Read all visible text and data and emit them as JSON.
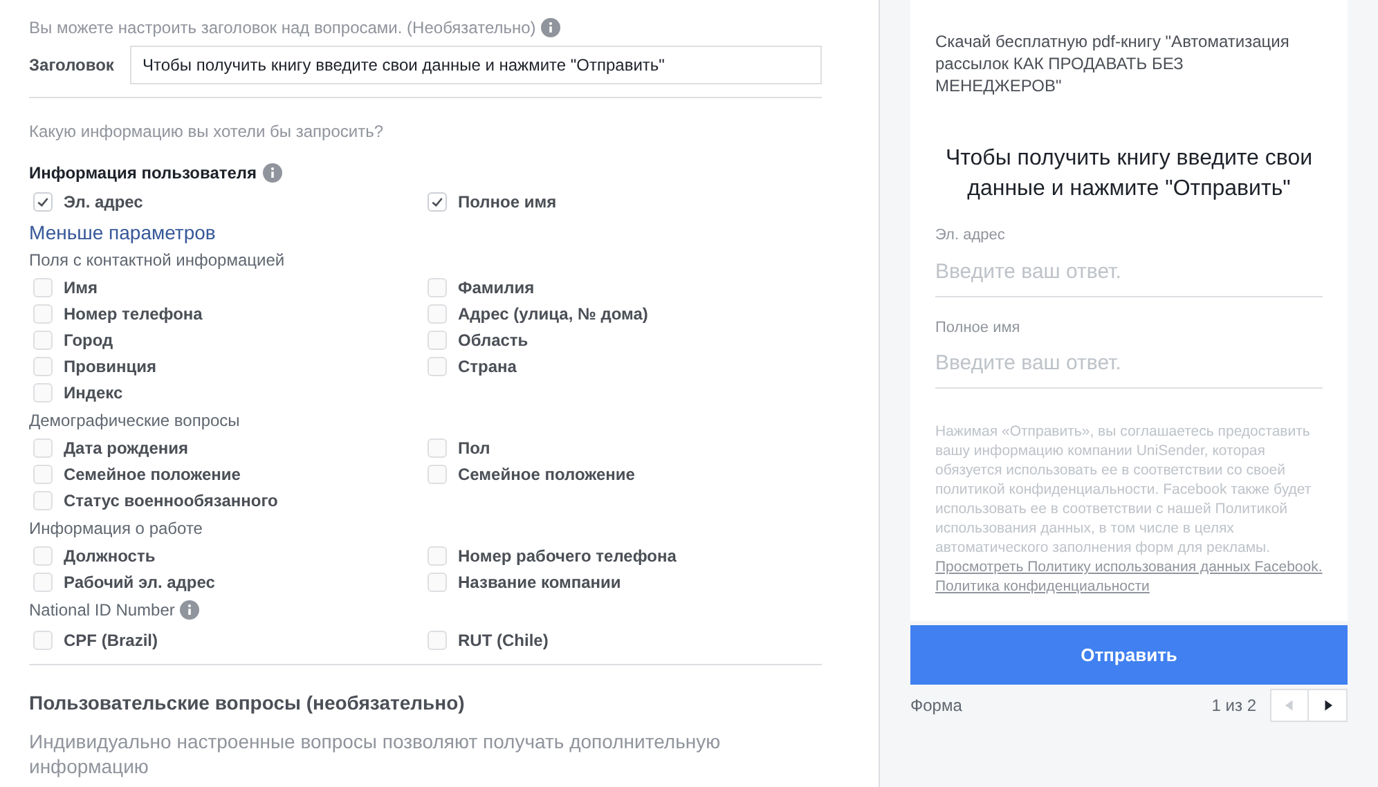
{
  "editor": {
    "heading_hint": "Вы можете настроить заголовок над вопросами. (Необязательно)",
    "headline": {
      "label": "Заголовок",
      "value": "Чтобы получить книгу введите свои данные и нажмите \"Отправить\""
    },
    "question_prompt": "Какую информацию вы хотели бы запросить?",
    "user_info": {
      "title": "Информация пользователя",
      "options": [
        {
          "label": "Эл. адрес",
          "checked": true
        },
        {
          "label": "Полное имя",
          "checked": true
        }
      ]
    },
    "toggle_link": "Меньше параметров",
    "groups": [
      {
        "title": "Поля с контактной информацией",
        "info": false,
        "options": [
          {
            "label": "Имя",
            "checked": false
          },
          {
            "label": "Фамилия",
            "checked": false
          },
          {
            "label": "Номер телефона",
            "checked": false
          },
          {
            "label": "Адрес (улица, № дома)",
            "checked": false
          },
          {
            "label": "Город",
            "checked": false
          },
          {
            "label": "Область",
            "checked": false
          },
          {
            "label": "Провинция",
            "checked": false
          },
          {
            "label": "Страна",
            "checked": false
          },
          {
            "label": "Индекс",
            "checked": false
          }
        ]
      },
      {
        "title": "Демографические вопросы",
        "info": false,
        "options": [
          {
            "label": "Дата рождения",
            "checked": false
          },
          {
            "label": "Пол",
            "checked": false
          },
          {
            "label": "Семейное положение",
            "checked": false
          },
          {
            "label": "Семейное положение",
            "checked": false
          },
          {
            "label": "Статус военнообязанного",
            "checked": false
          }
        ]
      },
      {
        "title": "Информация о работе",
        "info": false,
        "options": [
          {
            "label": "Должность",
            "checked": false
          },
          {
            "label": "Номер рабочего телефона",
            "checked": false
          },
          {
            "label": "Рабочий эл. адрес",
            "checked": false
          },
          {
            "label": "Название компании",
            "checked": false
          }
        ]
      },
      {
        "title": "National ID Number",
        "info": true,
        "options": [
          {
            "label": "CPF (Brazil)",
            "checked": false
          },
          {
            "label": "RUT (Chile)",
            "checked": false
          }
        ]
      }
    ],
    "custom_title": "Пользовательские вопросы (необязательно)",
    "custom_desc": "Индивидуально настроенные вопросы позволяют получать дополнительную информацию"
  },
  "preview": {
    "intro": "Скачай бесплатную pdf-книгу \"Автоматизация рассылок КАК ПРОДАВАТЬ БЕЗ МЕНЕДЖЕРОВ\"",
    "headline": "Чтобы получить книгу введите свои данные и нажмите \"Отправить\"",
    "fields": [
      {
        "label": "Эл. адрес",
        "placeholder": "Введите ваш ответ."
      },
      {
        "label": "Полное имя",
        "placeholder": "Введите ваш ответ."
      }
    ],
    "legal": "Нажимая «Отправить», вы соглашаетесь предоставить вашу информацию компании UniSender, которая обязуется использовать ее в соответствии со своей политикой конфиденциальности. Facebook также будет использовать ее в соответствии с нашей Политикой использования данных, в том числе в целях автоматического заполнения форм для рекламы.",
    "links": [
      "Просмотреть Политику использования данных Facebook.",
      "Политика конфиденциальности"
    ],
    "submit": "Отправить",
    "footer_label": "Форма",
    "page": "1 из 2"
  }
}
